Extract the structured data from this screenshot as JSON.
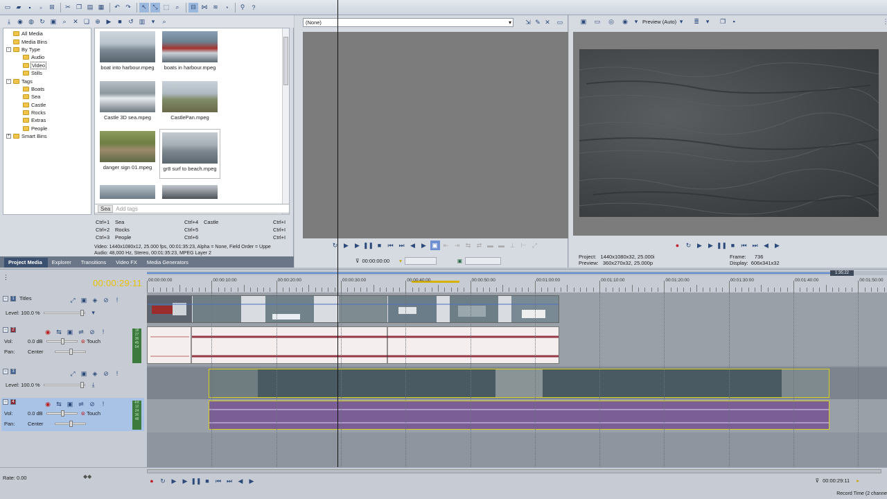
{
  "explorer": {
    "tree": [
      {
        "label": "All Media",
        "level": 1,
        "exp": ""
      },
      {
        "label": "Media Bins",
        "level": 1,
        "exp": ""
      },
      {
        "label": "By Type",
        "level": 1,
        "exp": "-"
      },
      {
        "label": "Audio",
        "level": 2,
        "exp": ""
      },
      {
        "label": "Video",
        "level": 2,
        "exp": "",
        "selected": true
      },
      {
        "label": "Stills",
        "level": 2,
        "exp": ""
      },
      {
        "label": "Tags",
        "level": 1,
        "exp": "-"
      },
      {
        "label": "Boats",
        "level": 2,
        "exp": ""
      },
      {
        "label": "Sea",
        "level": 2,
        "exp": ""
      },
      {
        "label": "Castle",
        "level": 2,
        "exp": ""
      },
      {
        "label": "Rocks",
        "level": 2,
        "exp": ""
      },
      {
        "label": "Extras",
        "level": 2,
        "exp": ""
      },
      {
        "label": "People",
        "level": 2,
        "exp": ""
      },
      {
        "label": "Smart Bins",
        "level": 1,
        "exp": "+"
      }
    ],
    "thumbs": [
      {
        "name": "boat into harbour.mpeg"
      },
      {
        "name": "boats in harbour.mpeg"
      },
      {
        "name": "Castle 3D sea.mpeg"
      },
      {
        "name": "CastlePan.mpeg"
      },
      {
        "name": "danger sign 01.mpeg"
      },
      {
        "name": "gr8 surf to beach.mpeg",
        "selected": true
      }
    ],
    "tag_chip": "Sea",
    "tag_placeholder": "Add tags",
    "shortcuts": [
      [
        "Ctrl+1",
        "Sea",
        "Ctrl+4",
        "Castle",
        "Ctrl+I"
      ],
      [
        "Ctrl+2",
        "Rocks",
        "Ctrl+5",
        "",
        "Ctrl+I"
      ],
      [
        "Ctrl+3",
        "People",
        "Ctrl+6",
        "",
        "Ctrl+I"
      ]
    ],
    "info_video": "Video: 1440x1080x12, 25.000 fps, 00:01:35:23, Alpha = None, Field Order = Uppe",
    "info_audio": "Audio: 48,000 Hz, Stereo, 00:01:35:23, MPEG Layer 2",
    "tabs": [
      "Project Media",
      "Explorer",
      "Transitions",
      "Video FX",
      "Media Generators"
    ]
  },
  "trimmer": {
    "combo": "(None)",
    "time": "00:00:00:00"
  },
  "preview": {
    "mode": "Preview (Auto)",
    "project_label": "Project:",
    "project_value": "1440x1080x32, 25.000i",
    "preview_label": "Preview:",
    "preview_value": "360x270x32, 25.000p",
    "frame_label": "Frame:",
    "frame_value": "736",
    "display_label": "Display:",
    "display_value": "606x341x32"
  },
  "timeline": {
    "timecode": "00:00:29:11",
    "end_marker": "1:35:22",
    "ruler": [
      "00:00:00:00",
      "00:00:10:00",
      "00:00:20:00",
      "00:00:30:00",
      "00:00:40:00",
      "00:00:50:00",
      "00:01:00:00",
      "00:01:10:00",
      "00:01:20:00",
      "00:01:30:00",
      "00:01:40:00",
      "00:01:50:00"
    ],
    "tracks": [
      {
        "num": "1",
        "name": "Titles",
        "level": "Level: 100.0 %"
      },
      {
        "num": "2",
        "vol_label": "Vol:",
        "vol": "0.0 dB",
        "pan_label": "Pan:",
        "pan": "Center",
        "touch": "Touch",
        "vu": [
          "18",
          "27",
          "36",
          "45",
          "54"
        ]
      },
      {
        "num": "3",
        "level": "Level: 100.0 %"
      },
      {
        "num": "4",
        "vol_label": "Vol:",
        "vol": "0.0 dB",
        "pan_label": "Pan:",
        "pan": "Center",
        "touch": "Touch",
        "vu": [
          "-Inf.",
          "12",
          "24",
          "36",
          "48"
        ]
      }
    ],
    "rate": "Rate: 0.00",
    "bottom_time": "00:00:29:11",
    "record_time": "Record Time (2 channe"
  }
}
